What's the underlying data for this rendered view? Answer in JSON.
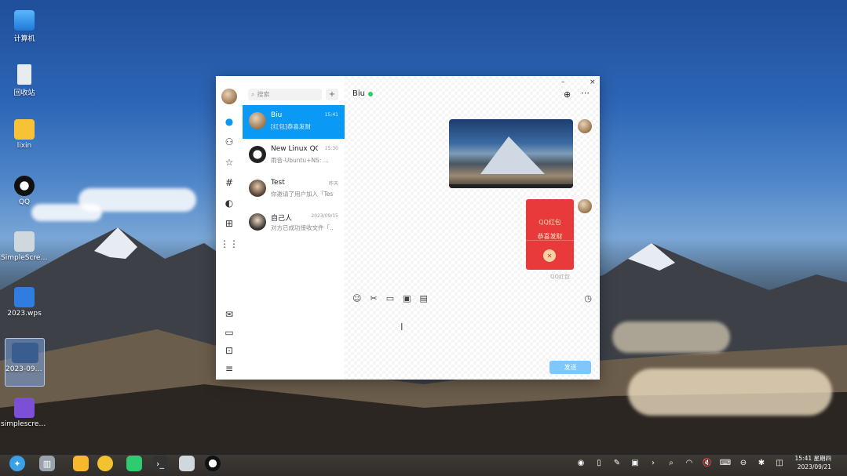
{
  "desktop": {
    "icons": [
      {
        "label": "计算机",
        "icon": "computer-icon"
      },
      {
        "label": "回收站",
        "icon": "trash-icon"
      },
      {
        "label": "lixin",
        "icon": "folder-icon"
      },
      {
        "label": "QQ",
        "icon": "qq-icon"
      },
      {
        "label": "SimpleScreenRecorder",
        "icon": "app-icon"
      },
      {
        "label": "2023.wps",
        "icon": "wps-icon"
      },
      {
        "label": "2023-09-21_15-27-33.png",
        "icon": "image-file-icon"
      },
      {
        "label": "simplescreenrecorder-202...",
        "icon": "video-file-icon"
      }
    ]
  },
  "window": {
    "controls": {
      "minimize": "–",
      "close": "×"
    },
    "search_placeholder": "搜索",
    "add_label": "+",
    "conversations": [
      {
        "name": "Biu",
        "time": "15:41",
        "preview": "[红包]恭喜发财",
        "active": true
      },
      {
        "name": "New Linux QQ...",
        "time": "15:30",
        "preview": "雨音-Ubuntu+NS: ...",
        "active": false
      },
      {
        "name": "Test",
        "time": "昨天",
        "preview": "你邀请了用户加入「Test」",
        "active": false
      },
      {
        "name": "自己人",
        "time": "2023/09/15",
        "preview": "对方已成功接收文件「...",
        "active": false
      }
    ],
    "chat": {
      "title": "Biu",
      "status_color": "#2ecc71",
      "red_envelope": {
        "top_text": "QQ红包",
        "label": "恭喜发财",
        "tag": "QQ红包"
      },
      "send_label": "发送",
      "toolbar_icons": [
        "emoji-icon",
        "scissors-icon",
        "folder-icon",
        "image-icon",
        "video-icon",
        "history-icon"
      ]
    },
    "accent_color": "#0a99f4"
  },
  "taskbar": {
    "clock_time": "15:41 星期四",
    "clock_date": "2023/09/21"
  }
}
